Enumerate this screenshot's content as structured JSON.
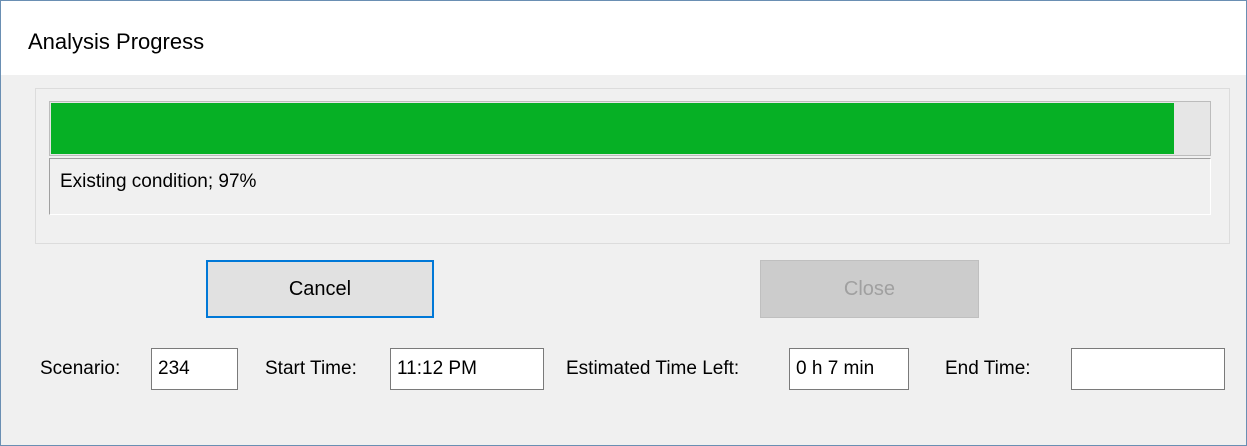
{
  "window": {
    "title": "Analysis Progress"
  },
  "progress": {
    "percent": 97,
    "status_text": "Existing condition; 97%",
    "bar_color": "#06b025"
  },
  "buttons": {
    "cancel_label": "Cancel",
    "close_label": "Close"
  },
  "fields": {
    "scenario": {
      "label": "Scenario:",
      "value": "234"
    },
    "start_time": {
      "label": "Start Time:",
      "value": "11:12 PM"
    },
    "estimated_time_left": {
      "label": "Estimated Time Left:",
      "value": "0 h 7 min"
    },
    "end_time": {
      "label": "End Time:",
      "value": ""
    }
  },
  "colors": {
    "focus_border": "#0078d7",
    "disabled_text": "#a0a0a0"
  }
}
